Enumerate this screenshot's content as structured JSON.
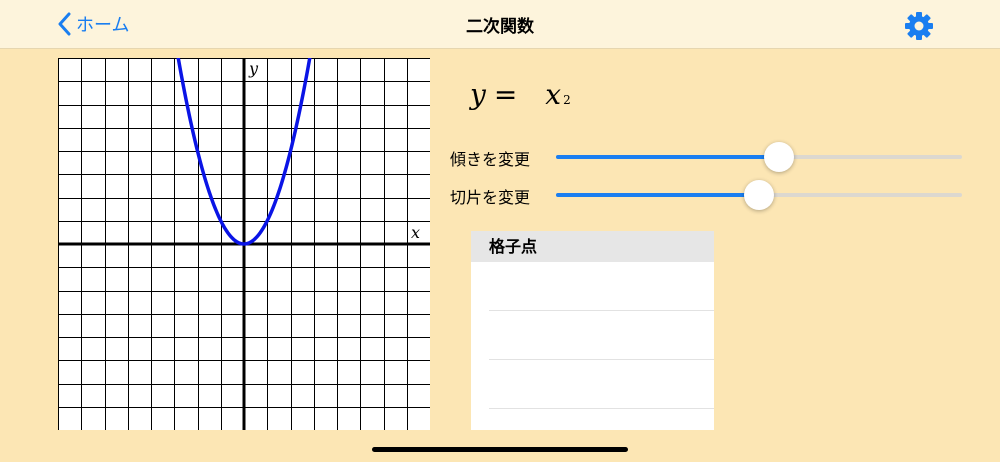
{
  "navbar": {
    "back_label": "ホーム",
    "title": "二次関数",
    "settings_icon": "gear-icon",
    "accent": "#1a7ef0"
  },
  "graph": {
    "x_label": "x",
    "y_label": "y",
    "curve_color": "#0a14e6",
    "function": "y = x^2"
  },
  "formula": {
    "lhs": "y",
    "equals": "=",
    "term": "x",
    "exponent": "2"
  },
  "sliders": [
    {
      "label": "傾きを変更",
      "value": 0.55
    },
    {
      "label": "切片を変更",
      "value": 0.5
    }
  ],
  "lattice_points": {
    "header": "格子点",
    "rows": [
      "",
      "",
      "",
      ""
    ]
  },
  "colors": {
    "background": "#fce6b4",
    "navbar": "#fdf4dc"
  }
}
